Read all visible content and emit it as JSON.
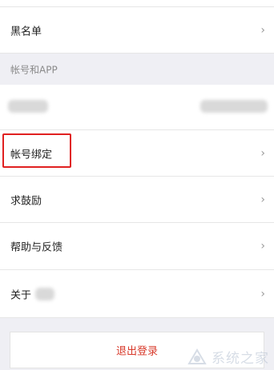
{
  "settings": {
    "blacklist_label": "黑名单",
    "account_section_header": "帐号和APP",
    "account_binding_label": "帐号绑定",
    "encourage_label": "求鼓励",
    "help_feedback_label": "帮助与反馈",
    "about_label": "关于",
    "chevron": "›"
  },
  "logout": {
    "label": "退出登录"
  },
  "watermark": {
    "text": "系统之家"
  },
  "colors": {
    "highlight": "#e02020",
    "logout_text": "#d83a2b",
    "background": "#efeff4"
  }
}
